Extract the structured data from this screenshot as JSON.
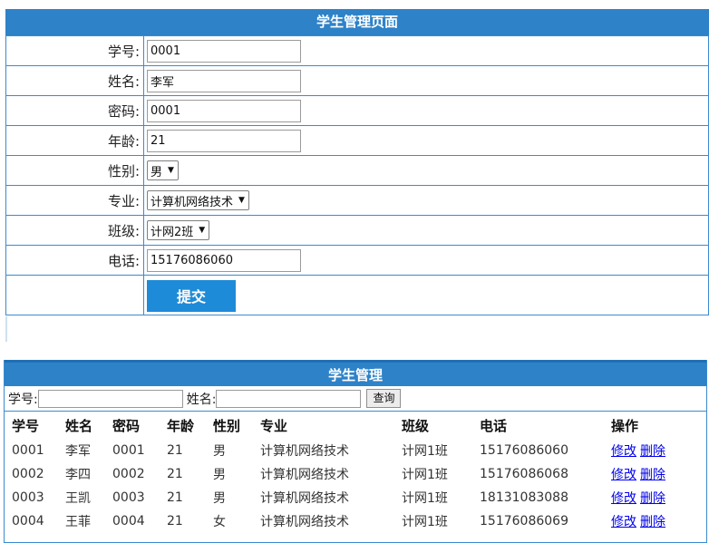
{
  "form": {
    "title": "学生管理页面",
    "fields": {
      "id_label": "学号:",
      "id_value": "0001",
      "name_label": "姓名:",
      "name_value": "李军",
      "password_label": "密码:",
      "password_value": "0001",
      "age_label": "年龄:",
      "age_value": "21",
      "gender_label": "性别:",
      "gender_value": "男",
      "major_label": "专业:",
      "major_value": "计算机网络技术",
      "class_label": "班级:",
      "class_value": "计网2班",
      "phone_label": "电话:",
      "phone_value": "15176086060"
    },
    "submit_label": "提交"
  },
  "list": {
    "title": "学生管理",
    "search": {
      "id_label": "学号:",
      "name_label": "姓名:",
      "query_label": "查询"
    },
    "headers": [
      "学号",
      "姓名",
      "密码",
      "年龄",
      "性别",
      "专业",
      "班级",
      "电话",
      "操作"
    ],
    "rows": [
      {
        "id": "0001",
        "name": "李军",
        "pwd": "0001",
        "age": "21",
        "gender": "男",
        "major": "计算机网络技术",
        "class": "计网1班",
        "phone": "15176086060"
      },
      {
        "id": "0002",
        "name": "李四",
        "pwd": "0002",
        "age": "21",
        "gender": "男",
        "major": "计算机网络技术",
        "class": "计网1班",
        "phone": "15176086068"
      },
      {
        "id": "0003",
        "name": "王凯",
        "pwd": "0003",
        "age": "21",
        "gender": "男",
        "major": "计算机网络技术",
        "class": "计网1班",
        "phone": "18131083088"
      },
      {
        "id": "0004",
        "name": "王菲",
        "pwd": "0004",
        "age": "21",
        "gender": "女",
        "major": "计算机网络技术",
        "class": "计网1班",
        "phone": "15176086069"
      }
    ],
    "edit_label": "修改",
    "delete_label": "删除"
  },
  "colors": {
    "header_bg": "#2e82c8",
    "border": "#3a8bd0",
    "submit_bg": "#1e8bd8",
    "link": "#0000ee"
  },
  "icons": {
    "dropdown": "dropdown-arrow-icon"
  }
}
